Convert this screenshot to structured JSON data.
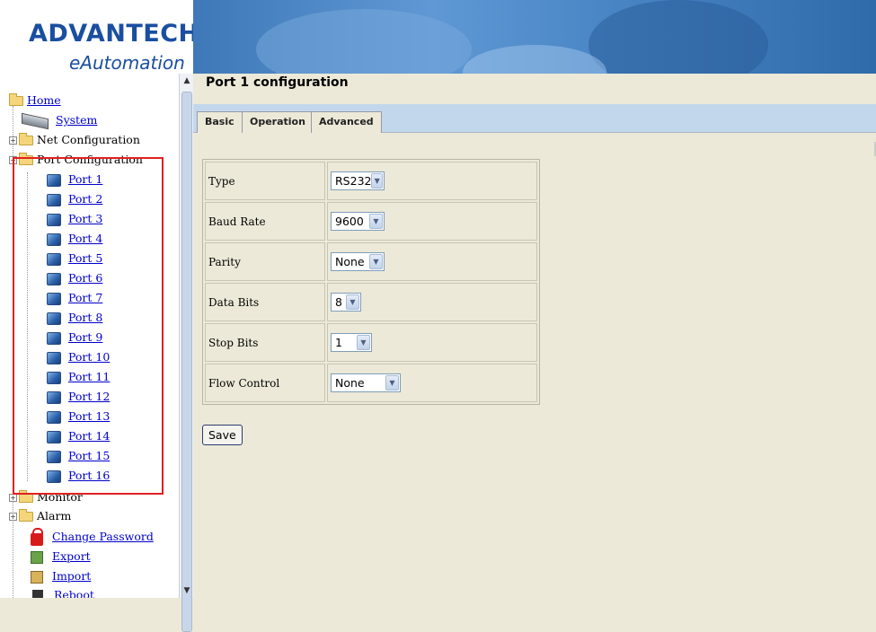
{
  "logo": {
    "brand": "ADVANTECH",
    "sub": "eAutomation"
  },
  "tree": {
    "home": "Home",
    "system": "System",
    "net": "Net Configuration",
    "port_config": "Port Configuration",
    "ports": [
      "Port 1",
      "Port 2",
      "Port 3",
      "Port 4",
      "Port 5",
      "Port 6",
      "Port 7",
      "Port 8",
      "Port 9",
      "Port 10",
      "Port 11",
      "Port 12",
      "Port 13",
      "Port 14",
      "Port 15",
      "Port 16"
    ],
    "monitor": "Monitor",
    "alarm": "Alarm",
    "change_password": "Change Password",
    "export": "Export",
    "import": "Import",
    "reboot": "Reboot"
  },
  "page": {
    "title": "Port 1 configuration"
  },
  "tabs": [
    "Basic",
    "Operation",
    "Advanced"
  ],
  "form": {
    "rows": [
      {
        "label": "Type",
        "value": "RS232"
      },
      {
        "label": "Baud Rate",
        "value": "9600"
      },
      {
        "label": "Parity",
        "value": "None"
      },
      {
        "label": "Data Bits",
        "value": "8"
      },
      {
        "label": "Stop Bits",
        "value": "1"
      },
      {
        "label": "Flow Control",
        "value": "None"
      }
    ],
    "save_label": "Save"
  },
  "icons": {
    "dropdown": "chevron-down-icon",
    "folder": "folder-icon",
    "port": "port-icon",
    "scroll_up": "scroll-up-arrow",
    "scroll_down": "scroll-down-arrow"
  },
  "colors": {
    "accent": "#1a4fa0",
    "link": "#0000cc",
    "highlight": "#e02020",
    "tabbar": "#c3d7ec",
    "background": "#ece9d8"
  }
}
